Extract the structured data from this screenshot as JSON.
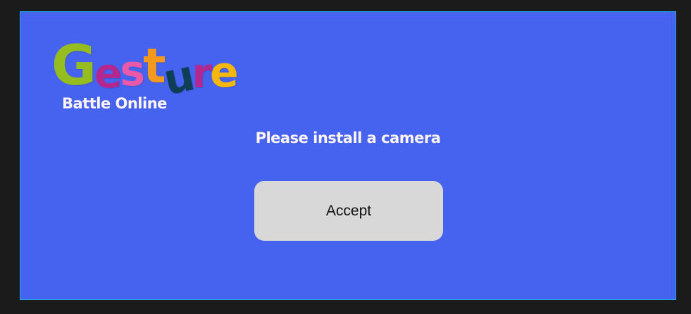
{
  "logo": {
    "letters": [
      {
        "char": "G",
        "color": "#96bd1f"
      },
      {
        "char": "e",
        "color": "#b4278f"
      },
      {
        "char": "s",
        "color": "#e85aa9"
      },
      {
        "char": "t",
        "color": "#f39a1e"
      },
      {
        "char": "u",
        "color": "#0f3f57"
      },
      {
        "char": "r",
        "color": "#b4278f"
      },
      {
        "char": "e",
        "color": "#f6b70c"
      }
    ],
    "subtitle": "Battle Online"
  },
  "dialog": {
    "message": "Please install a camera",
    "accept_label": "Accept"
  },
  "colors": {
    "background": "#1b1b1b",
    "panel": "#4563ef",
    "panel_border": "#23a6e6",
    "button": "#d8d8d8",
    "text_light": "#fff4f8"
  }
}
